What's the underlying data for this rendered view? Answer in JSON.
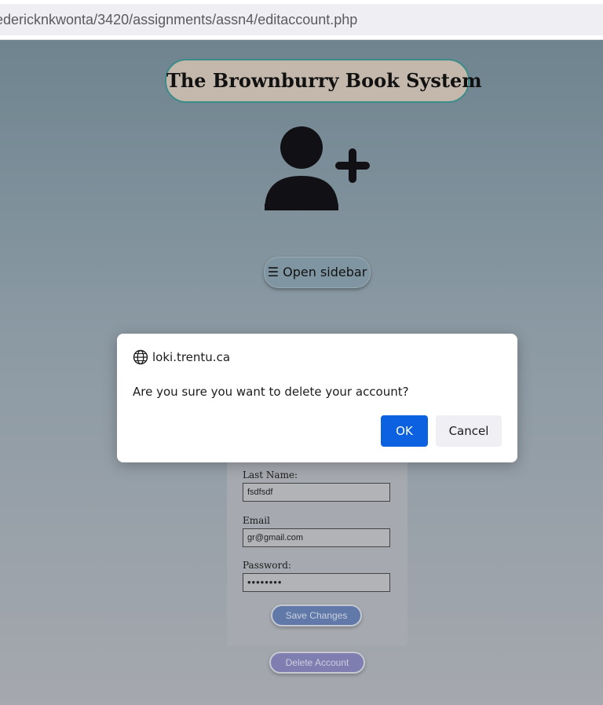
{
  "browser": {
    "url": "edericknkwonta/3420/assignments/assn4/editaccount.php"
  },
  "page": {
    "title": "The Brownburry Book System",
    "add_user_icon": "user-plus-icon",
    "sidebar_button": "☰ Open sidebar"
  },
  "form": {
    "last_name_label": "Last Name:",
    "last_name_value": "fsdfsdf",
    "email_label": "Email",
    "email_value": "gr@gmail.com",
    "password_label": "Password:",
    "password_value": "••••••••",
    "save_label": "Save Changes",
    "delete_label": "Delete Account"
  },
  "dialog": {
    "origin": "loki.trentu.ca",
    "origin_icon": "globe-icon",
    "message": "Are you sure you want to delete your account?",
    "ok_label": "OK",
    "cancel_label": "Cancel"
  },
  "colors": {
    "ok_button": "#0b61e0",
    "title_border": "#3c8c8a"
  }
}
